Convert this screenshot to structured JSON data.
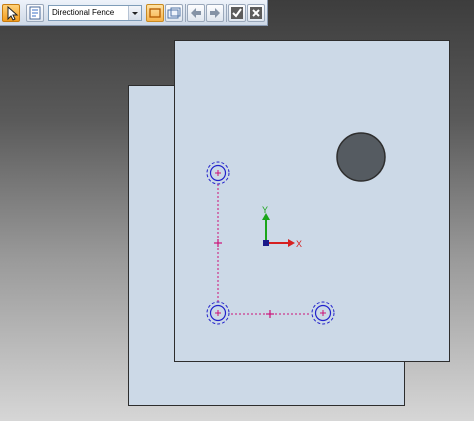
{
  "toolbar": {
    "select_tool_icon": "arrow-cursor-icon",
    "selection_filter_icon": "filter-list-icon",
    "selection_mode": "Directional Fence",
    "buttons": [
      {
        "name": "fence-select-button",
        "icon": "rectangle-fence-icon",
        "active": true
      },
      {
        "name": "fence-options-button",
        "icon": "folder-fence-icon",
        "active": false
      },
      {
        "name": "previous-button",
        "icon": "arrow-left-icon",
        "active": false
      },
      {
        "name": "next-button",
        "icon": "arrow-right-icon",
        "active": false
      },
      {
        "name": "accept-button",
        "icon": "check-icon",
        "active": false
      },
      {
        "name": "cancel-button",
        "icon": "close-icon",
        "active": false
      }
    ]
  },
  "triad": {
    "y_label": "Y",
    "x_label": "X"
  },
  "colors": {
    "sheet": "#ccd9e7",
    "hole_marker": "#2222cc",
    "dimension_line": "#cc1177",
    "x_axis": "#d62020",
    "y_axis": "#1aa51a",
    "origin": "#1a1a8a",
    "toolbar_active": "#f6b24a"
  }
}
